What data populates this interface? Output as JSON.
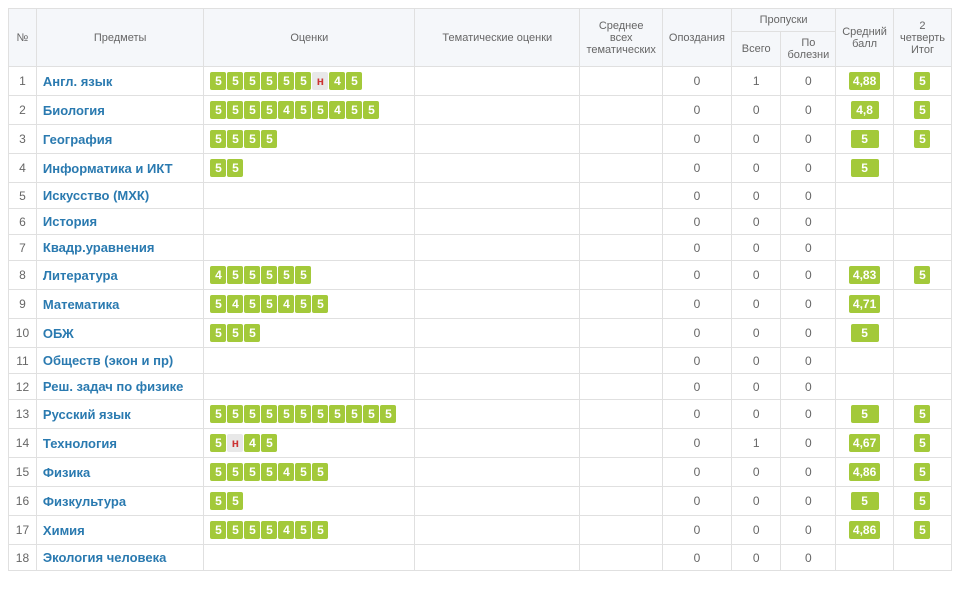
{
  "headers": {
    "num": "№",
    "subjects": "Предметы",
    "grades": "Оценки",
    "thematic": "Тематические оценки",
    "avg_thematic": "Среднее всех тематических",
    "late": "Опоздания",
    "absences": "Пропуски",
    "absent_total": "Всего",
    "absent_sick": "По болезни",
    "avg": "Средний балл",
    "quarter": "2 четверть Итог"
  },
  "rows": [
    {
      "n": "1",
      "subject": "Англ. язык",
      "grades": [
        "5",
        "5",
        "5",
        "5",
        "5",
        "5",
        "н",
        "4",
        "5"
      ],
      "late": "0",
      "abs_total": "1",
      "abs_sick": "0",
      "avg": "4,88",
      "quarter": "5"
    },
    {
      "n": "2",
      "subject": "Биология",
      "grades": [
        "5",
        "5",
        "5",
        "5",
        "4",
        "5",
        "5",
        "4",
        "5",
        "5"
      ],
      "late": "0",
      "abs_total": "0",
      "abs_sick": "0",
      "avg": "4,8",
      "quarter": "5"
    },
    {
      "n": "3",
      "subject": "География",
      "grades": [
        "5",
        "5",
        "5",
        "5"
      ],
      "late": "0",
      "abs_total": "0",
      "abs_sick": "0",
      "avg": "5",
      "quarter": "5"
    },
    {
      "n": "4",
      "subject": "Информатика и ИКТ",
      "grades": [
        "5",
        "5"
      ],
      "late": "0",
      "abs_total": "0",
      "abs_sick": "0",
      "avg": "5",
      "quarter": ""
    },
    {
      "n": "5",
      "subject": "Искусство (МХК)",
      "grades": [],
      "late": "0",
      "abs_total": "0",
      "abs_sick": "0",
      "avg": "",
      "quarter": ""
    },
    {
      "n": "6",
      "subject": "История",
      "grades": [],
      "late": "0",
      "abs_total": "0",
      "abs_sick": "0",
      "avg": "",
      "quarter": ""
    },
    {
      "n": "7",
      "subject": "Квадр.уравнения",
      "grades": [],
      "late": "0",
      "abs_total": "0",
      "abs_sick": "0",
      "avg": "",
      "quarter": ""
    },
    {
      "n": "8",
      "subject": "Литература",
      "grades": [
        "4",
        "5",
        "5",
        "5",
        "5",
        "5"
      ],
      "late": "0",
      "abs_total": "0",
      "abs_sick": "0",
      "avg": "4,83",
      "quarter": "5"
    },
    {
      "n": "9",
      "subject": "Математика",
      "grades": [
        "5",
        "4",
        "5",
        "5",
        "4",
        "5",
        "5"
      ],
      "late": "0",
      "abs_total": "0",
      "abs_sick": "0",
      "avg": "4,71",
      "quarter": ""
    },
    {
      "n": "10",
      "subject": "ОБЖ",
      "grades": [
        "5",
        "5",
        "5"
      ],
      "late": "0",
      "abs_total": "0",
      "abs_sick": "0",
      "avg": "5",
      "quarter": ""
    },
    {
      "n": "11",
      "subject": "Обществ (экон и пр)",
      "grades": [],
      "late": "0",
      "abs_total": "0",
      "abs_sick": "0",
      "avg": "",
      "quarter": ""
    },
    {
      "n": "12",
      "subject": "Реш. задач по физике",
      "grades": [],
      "late": "0",
      "abs_total": "0",
      "abs_sick": "0",
      "avg": "",
      "quarter": ""
    },
    {
      "n": "13",
      "subject": "Русский язык",
      "grades": [
        "5",
        "5",
        "5",
        "5",
        "5",
        "5",
        "5",
        "5",
        "5",
        "5",
        "5"
      ],
      "late": "0",
      "abs_total": "0",
      "abs_sick": "0",
      "avg": "5",
      "quarter": "5"
    },
    {
      "n": "14",
      "subject": "Технология",
      "grades": [
        "5",
        "н",
        "4",
        "5"
      ],
      "late": "0",
      "abs_total": "1",
      "abs_sick": "0",
      "avg": "4,67",
      "quarter": "5"
    },
    {
      "n": "15",
      "subject": "Физика",
      "grades": [
        "5",
        "5",
        "5",
        "5",
        "4",
        "5",
        "5"
      ],
      "late": "0",
      "abs_total": "0",
      "abs_sick": "0",
      "avg": "4,86",
      "quarter": "5"
    },
    {
      "n": "16",
      "subject": "Физкультура",
      "grades": [
        "5",
        "5"
      ],
      "late": "0",
      "abs_total": "0",
      "abs_sick": "0",
      "avg": "5",
      "quarter": "5"
    },
    {
      "n": "17",
      "subject": "Химия",
      "grades": [
        "5",
        "5",
        "5",
        "5",
        "4",
        "5",
        "5"
      ],
      "late": "0",
      "abs_total": "0",
      "abs_sick": "0",
      "avg": "4,86",
      "quarter": "5"
    },
    {
      "n": "18",
      "subject": "Экология человека",
      "grades": [],
      "late": "0",
      "abs_total": "0",
      "abs_sick": "0",
      "avg": "",
      "quarter": ""
    }
  ]
}
